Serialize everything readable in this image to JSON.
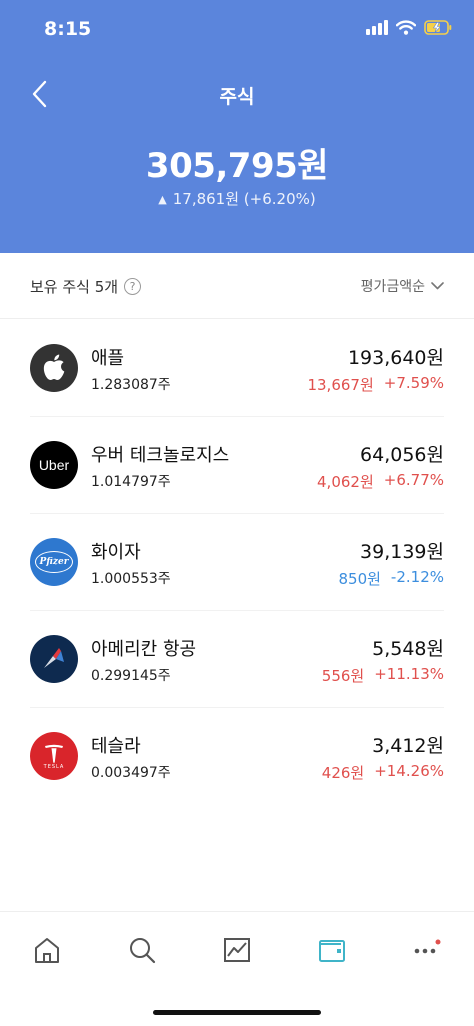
{
  "status": {
    "time": "8:15"
  },
  "header": {
    "title": "주식",
    "total": "305,795원",
    "change_arrow": "▲",
    "change": "17,861원 (+6.20%)"
  },
  "holdings": {
    "title": "보유 주식 5개",
    "help": "?",
    "sort_label": "평가금액순"
  },
  "stocks": [
    {
      "name": "애플",
      "shares": "1.283087주",
      "value": "193,640원",
      "gain": "13,667원",
      "rate": "+7.59%",
      "direction": "up",
      "logo": "apple-logo"
    },
    {
      "name": "우버 테크놀로지스",
      "shares": "1.014797주",
      "value": "64,056원",
      "gain": "4,062원",
      "rate": "+6.77%",
      "direction": "up",
      "logo": "uber-logo",
      "logo_text": "Uber"
    },
    {
      "name": "화이자",
      "shares": "1.000553주",
      "value": "39,139원",
      "gain": "850원",
      "rate": "-2.12%",
      "direction": "down",
      "logo": "pfizer-logo",
      "logo_text": "Pfizer"
    },
    {
      "name": "아메리칸 항공",
      "shares": "0.299145주",
      "value": "5,548원",
      "gain": "556원",
      "rate": "+11.13%",
      "direction": "up",
      "logo": "american-airlines-logo"
    },
    {
      "name": "테슬라",
      "shares": "0.003497주",
      "value": "3,412원",
      "gain": "426원",
      "rate": "+14.26%",
      "direction": "up",
      "logo": "tesla-logo",
      "logo_text": "TESLA"
    }
  ],
  "tabs": [
    {
      "name": "home",
      "icon": "home-icon"
    },
    {
      "name": "search",
      "icon": "search-icon"
    },
    {
      "name": "chart",
      "icon": "chart-icon"
    },
    {
      "name": "wallet",
      "icon": "wallet-icon",
      "active": true
    },
    {
      "name": "more",
      "icon": "more-icon",
      "badge": true
    }
  ],
  "colors": {
    "header_bg": "#5b85dc",
    "gain": "#e0504d",
    "loss": "#3c8ede",
    "active_tab": "#3fb4c8"
  }
}
